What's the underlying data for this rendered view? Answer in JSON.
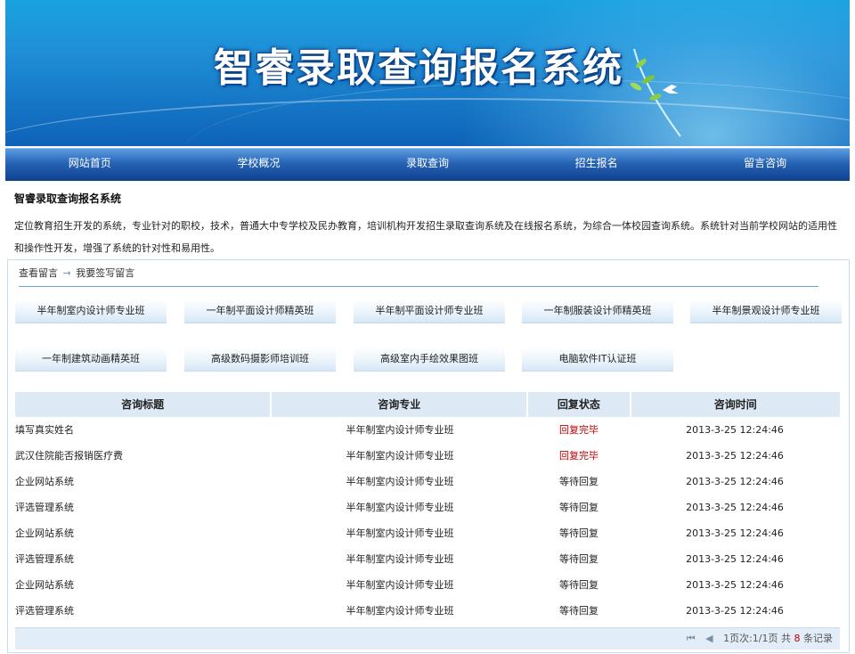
{
  "banner": {
    "title": "智睿录取查询报名系统"
  },
  "nav": [
    "网站首页",
    "学校概况",
    "录取查询",
    "招生报名",
    "留言咨询"
  ],
  "intro": {
    "title": "智睿录取查询报名系统",
    "text": "定位教育招生开发的系统，专业针对的职校，技术，普通大中专学校及民办教育，培训机构开发招生录取查询系统及在线报名系统，为综合一体校园查询系统。系统针对当前学校网站的适用性和操作性开发，增强了系统的针对性和易用性。"
  },
  "breadcrumb": {
    "view": "查看留言",
    "write": "我要签写留言"
  },
  "courses": [
    "半年制室内设计师专业班",
    "一年制平面设计师精英班",
    "半年制平面设计师专业班",
    "一年制服装设计师精英班",
    "半年制景观设计师专业班",
    "一年制建筑动画精英班",
    "高级数码摄影师培训班",
    "高级室内手绘效果图班",
    "电脑软件IT认证班"
  ],
  "table": {
    "headers": [
      "咨询标题",
      "咨询专业",
      "回复状态",
      "咨询时间"
    ],
    "rows": [
      [
        "填写真实姓名",
        "半年制室内设计师专业班",
        "回复完毕",
        "2013-3-25 12:24:46"
      ],
      [
        "武汉住院能否报销医疗费",
        "半年制室内设计师专业班",
        "回复完毕",
        "2013-3-25 12:24:46"
      ],
      [
        "企业网站系统",
        "半年制室内设计师专业班",
        "等待回复",
        "2013-3-25 12:24:46"
      ],
      [
        "评选管理系统",
        "半年制室内设计师专业班",
        "等待回复",
        "2013-3-25 12:24:46"
      ],
      [
        "企业网站系统",
        "半年制室内设计师专业班",
        "等待回复",
        "2013-3-25 12:24:46"
      ],
      [
        "评选管理系统",
        "半年制室内设计师专业班",
        "等待回复",
        "2013-3-25 12:24:46"
      ],
      [
        "企业网站系统",
        "半年制室内设计师专业班",
        "等待回复",
        "2013-3-25 12:24:46"
      ],
      [
        "评选管理系统",
        "半年制室内设计师专业班",
        "等待回复",
        "2013-3-25 12:24:46"
      ]
    ]
  },
  "pager": {
    "page_text": "1页次:1/1页 共",
    "count": "8",
    "unit": "条记录"
  },
  "colors": {
    "accent": "#1f8fd7",
    "nav": "#2663b4",
    "done": "#c00000"
  }
}
